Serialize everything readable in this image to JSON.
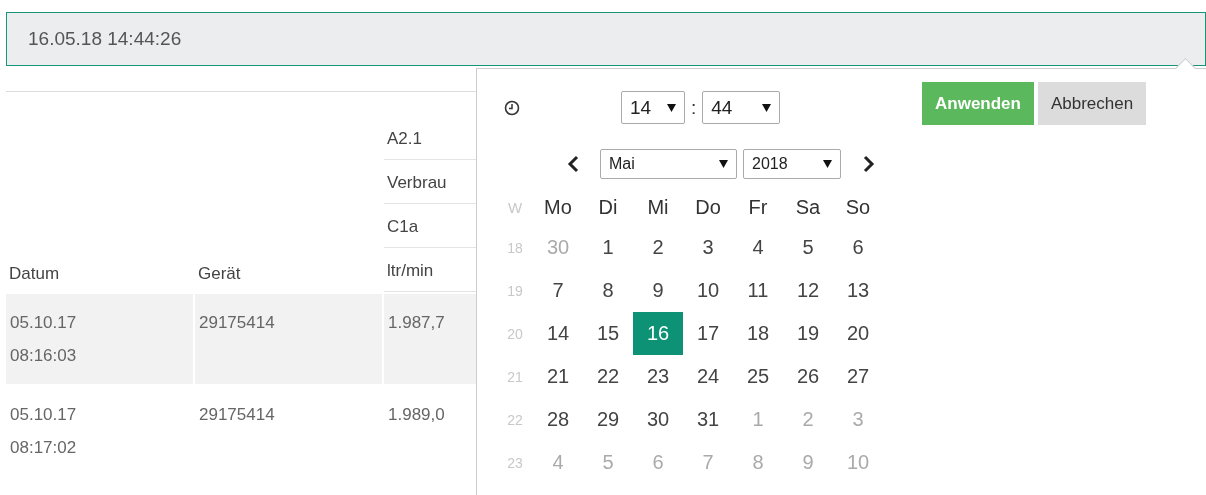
{
  "datetime_field": {
    "value": "16.05.18 14:44:26"
  },
  "table": {
    "columns": [
      "Datum",
      "Gerät"
    ],
    "column_3_header": [
      "A2.1",
      "Verbrau",
      "C1a",
      "ltr/min"
    ],
    "rows": [
      {
        "datum": "05.10.17 08:16:03",
        "geraet": "29175414",
        "column_3": "1.987,7"
      },
      {
        "datum": "05.10.17 08:17:02",
        "geraet": "29175414",
        "column_3": "1.989,0"
      }
    ]
  },
  "picker": {
    "hour": "14",
    "separator": ":",
    "minute": "44",
    "month": "Mai",
    "year": "2018",
    "buttons": [
      {
        "label": "Anwenden",
        "kind": "primary"
      },
      {
        "label": "Abbrechen",
        "kind": "secondary"
      }
    ],
    "week_label": "W",
    "weekdays": [
      "Mo",
      "Di",
      "Mi",
      "Do",
      "Fr",
      "Sa",
      "So"
    ],
    "weeks": [
      {
        "number": "18",
        "days": [
          {
            "label": "30",
            "outside": true,
            "selected": false
          },
          {
            "label": "1",
            "outside": false,
            "selected": false
          },
          {
            "label": "2",
            "outside": false,
            "selected": false
          },
          {
            "label": "3",
            "outside": false,
            "selected": false
          },
          {
            "label": "4",
            "outside": false,
            "selected": false
          },
          {
            "label": "5",
            "outside": false,
            "selected": false
          },
          {
            "label": "6",
            "outside": false,
            "selected": false
          }
        ]
      },
      {
        "number": "19",
        "days": [
          {
            "label": "7",
            "outside": false,
            "selected": false
          },
          {
            "label": "8",
            "outside": false,
            "selected": false
          },
          {
            "label": "9",
            "outside": false,
            "selected": false
          },
          {
            "label": "10",
            "outside": false,
            "selected": false
          },
          {
            "label": "11",
            "outside": false,
            "selected": false
          },
          {
            "label": "12",
            "outside": false,
            "selected": false
          },
          {
            "label": "13",
            "outside": false,
            "selected": false
          }
        ]
      },
      {
        "number": "20",
        "days": [
          {
            "label": "14",
            "outside": false,
            "selected": false
          },
          {
            "label": "15",
            "outside": false,
            "selected": false
          },
          {
            "label": "16",
            "outside": false,
            "selected": true
          },
          {
            "label": "17",
            "outside": false,
            "selected": false
          },
          {
            "label": "18",
            "outside": false,
            "selected": false
          },
          {
            "label": "19",
            "outside": false,
            "selected": false
          },
          {
            "label": "20",
            "outside": false,
            "selected": false
          }
        ]
      },
      {
        "number": "21",
        "days": [
          {
            "label": "21",
            "outside": false,
            "selected": false
          },
          {
            "label": "22",
            "outside": false,
            "selected": false
          },
          {
            "label": "23",
            "outside": false,
            "selected": false
          },
          {
            "label": "24",
            "outside": false,
            "selected": false
          },
          {
            "label": "25",
            "outside": false,
            "selected": false
          },
          {
            "label": "26",
            "outside": false,
            "selected": false
          },
          {
            "label": "27",
            "outside": false,
            "selected": false
          }
        ]
      },
      {
        "number": "22",
        "days": [
          {
            "label": "28",
            "outside": false,
            "selected": false
          },
          {
            "label": "29",
            "outside": false,
            "selected": false
          },
          {
            "label": "30",
            "outside": false,
            "selected": false
          },
          {
            "label": "31",
            "outside": false,
            "selected": false
          },
          {
            "label": "1",
            "outside": true,
            "selected": false
          },
          {
            "label": "2",
            "outside": true,
            "selected": false
          },
          {
            "label": "3",
            "outside": true,
            "selected": false
          }
        ]
      },
      {
        "number": "23",
        "days": [
          {
            "label": "4",
            "outside": true,
            "selected": false
          },
          {
            "label": "5",
            "outside": true,
            "selected": false
          },
          {
            "label": "6",
            "outside": true,
            "selected": false
          },
          {
            "label": "7",
            "outside": true,
            "selected": false
          },
          {
            "label": "8",
            "outside": true,
            "selected": false
          },
          {
            "label": "9",
            "outside": true,
            "selected": false
          },
          {
            "label": "10",
            "outside": true,
            "selected": false
          }
        ]
      }
    ]
  }
}
